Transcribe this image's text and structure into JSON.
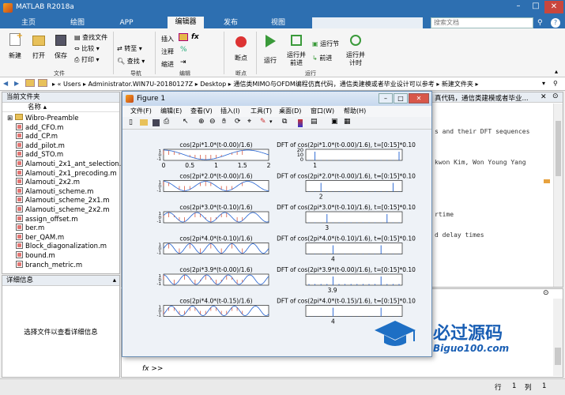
{
  "app": {
    "title": "MATLAB R2018a"
  },
  "window_controls": {
    "min": "–",
    "max": "□",
    "close": "✕"
  },
  "tabs": [
    "主页",
    "绘图",
    "APP",
    "编辑器",
    "发布",
    "视图"
  ],
  "search": {
    "placeholder": "搜索文档"
  },
  "ribbon": {
    "new": "新建",
    "open": "打开",
    "save": "保存",
    "find_files": "查找文件",
    "compare": "比较",
    "print": "打印",
    "insert": "插入",
    "comment": "注释",
    "indent": "缩进",
    "goto": "转至",
    "find": "查找",
    "fx": "fx",
    "breakpoints": "断点",
    "run": "运行",
    "run_advance": "运行并前进",
    "run_section": "运行节",
    "advance": "前进",
    "run_time": "运行并计时",
    "groups": {
      "file": "文件",
      "navigate": "导航",
      "edit": "编辑",
      "breakpoints": "断点",
      "run": "运行"
    }
  },
  "address": {
    "path": [
      "Users",
      "Administrator.WIN7U-20180127Z",
      "Desktop",
      "通信类MIMO与OFDM编程仿真代码，通信类建模或者毕业设计可以参考",
      "新建文件夹"
    ]
  },
  "file_panel": {
    "title": "当前文件夹",
    "column": "名称",
    "files": [
      "Wibro-Preamble",
      "add_CFO.m",
      "add_CP.m",
      "add_pilot.m",
      "add_STO.m",
      "Alamouti_2x1_ant_selection.m",
      "Alamouti_2x1_precoding.m",
      "Alamouti_2x2.m",
      "Alamouti_scheme.m",
      "Alamouti_scheme_2x1.m",
      "Alamouti_scheme_2x2.m",
      "assign_offset.m",
      "ber.m",
      "ber_QAM.m",
      "Block_diagonalization.m",
      "bound.m",
      "branch_metric.m"
    ]
  },
  "details": {
    "title": "详细信息",
    "empty": "选择文件以查看详细信息"
  },
  "editor_bg": {
    "path_tail": "真代码，通信类建模或者毕业...",
    "lines": [
      "s and their DFT sequences",
      "kwon Kim, Won Young Yang",
      "rtime",
      "d delay times"
    ]
  },
  "figure": {
    "title": "Figure 1",
    "menu": [
      "文件(F)",
      "编辑(E)",
      "查看(V)",
      "插入(I)",
      "工具(T)",
      "桌面(D)",
      "窗口(W)",
      "帮助(H)"
    ],
    "left_titles": [
      "cos(2pi*1.0*(t-0.00)/1.6)",
      "cos(2pi*2.0*(t-0.00)/1.6)",
      "cos(2pi*3.0*(t-0.10)/1.6)",
      "cos(2pi*4.0*(t-0.10)/1.6)",
      "cos(2pi*3.9*(t-0.00)/1.6)",
      "cos(2pi*4.0*(t-0.15)/1.6)"
    ],
    "right_titles": [
      "DFT of cos(2pi*1.0*(t-0.00)/1.6), t=[0:15]*0.10",
      "DFT of cos(2pi*2.0*(t-0.00)/1.6), t=[0:15]*0.10",
      "DFT of cos(2pi*3.0*(t-0.10)/1.6), t=[0:15]*0.10",
      "DFT of cos(2pi*4.0*(t-0.10)/1.6), t=[0:15]*0.10",
      "DFT of cos(2pi*3.9*(t-0.00)/1.6), t=[0:15]*0.10",
      "DFT of cos(2pi*4.0*(t-0.15)/1.6), t=[0:15]*0.10"
    ],
    "left_xticks": [
      "0",
      "0.5",
      "1",
      "1.5",
      "2"
    ],
    "left_yticks": [
      "1",
      "0",
      "-1"
    ],
    "dft_yticks": [
      "20",
      "10",
      "0"
    ],
    "dft_labels": [
      "1",
      "2",
      "3",
      "4",
      "3.9",
      "4"
    ],
    "freqs": [
      1.0,
      2.0,
      3.0,
      4.0,
      3.9,
      4.0
    ]
  },
  "command": {
    "prompt": "fx >>"
  },
  "status": {
    "row_label": "行",
    "row": "1",
    "col_label": "列",
    "col": "1"
  },
  "watermark": {
    "brand": "必过源码",
    "url": "Biguo100.com"
  }
}
